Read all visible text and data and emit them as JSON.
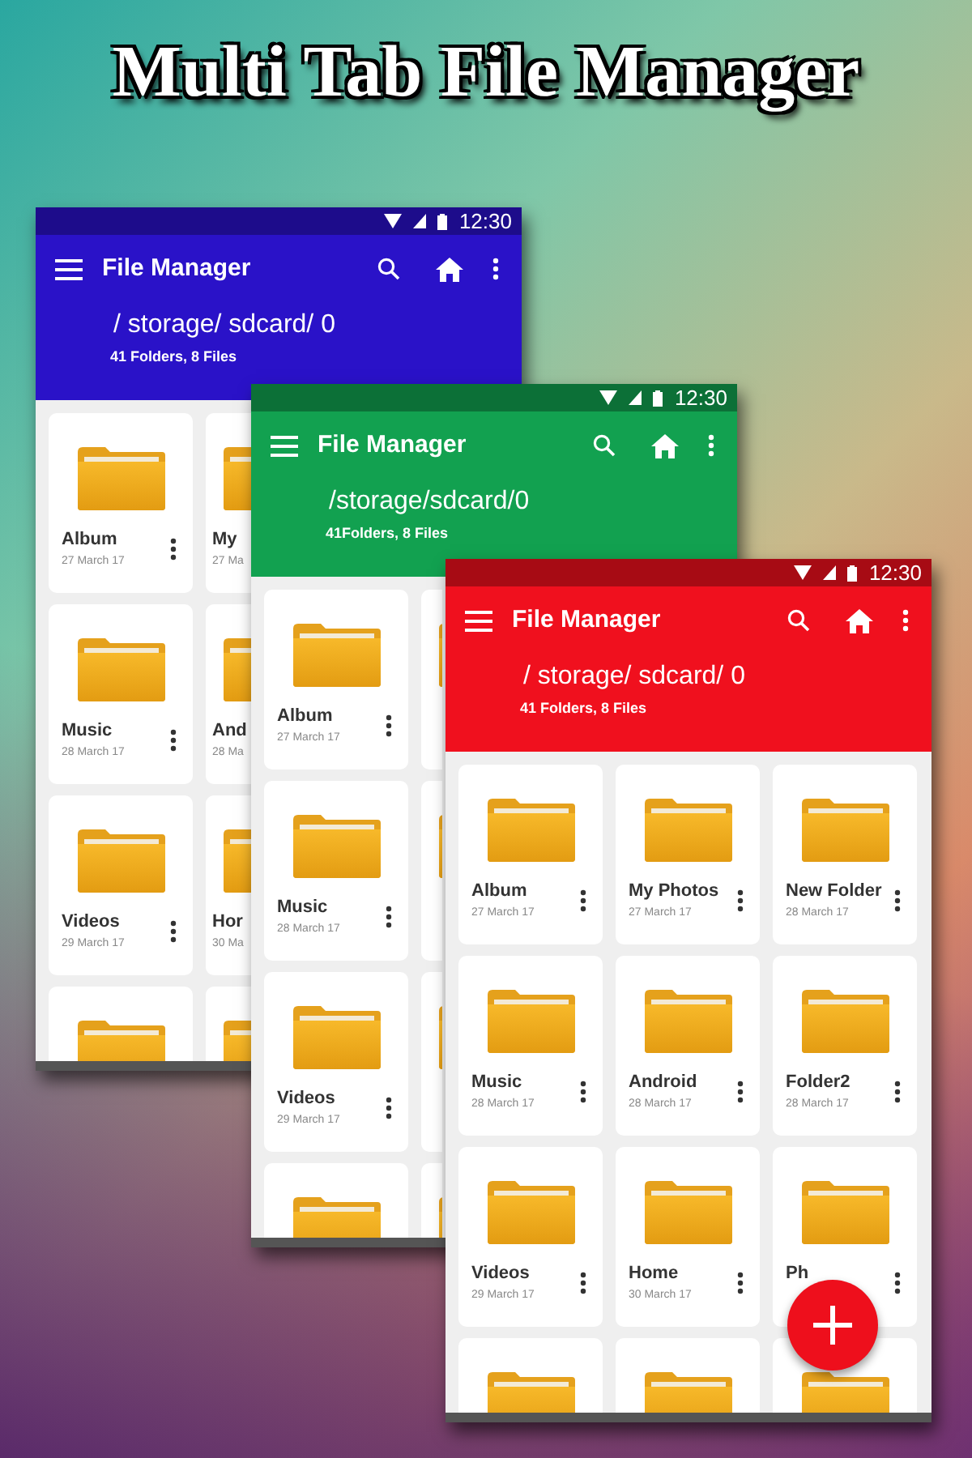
{
  "title": "Multi Tab File Manager",
  "screens": [
    {
      "color": "#2a12c8",
      "time": "12:30",
      "app_title": "File Manager",
      "path": "/ storage/ sdcard/ 0",
      "summary": "41 Folders, 8 Files",
      "rows": [
        [
          {
            "kind": "folder",
            "name": "Album",
            "date": "27 March 17"
          },
          {
            "kind": "folder",
            "name": "My",
            "date": "27 Ma"
          }
        ],
        [
          {
            "kind": "folder",
            "name": "Music",
            "date": "28 March 17"
          },
          {
            "kind": "folder",
            "name": "And",
            "date": "28 Ma"
          }
        ],
        [
          {
            "kind": "folder",
            "name": "Videos",
            "date": "29 March 17"
          },
          {
            "kind": "folder",
            "name": "Hor",
            "date": "30 Ma"
          }
        ],
        [
          {
            "kind": "cut"
          },
          {
            "kind": "cut"
          }
        ]
      ]
    },
    {
      "color": "#12a150",
      "time": "12:30",
      "app_title": "File Manager",
      "path": "/storage/sdcard/0",
      "summary": "41Folders, 8 Files",
      "rows": [
        [
          {
            "kind": "folder",
            "name": "Album",
            "date": "27 March 17"
          },
          {
            "kind": "cut"
          }
        ],
        [
          {
            "kind": "folder",
            "name": "Music",
            "date": "28 March 17"
          },
          {
            "kind": "cut"
          }
        ],
        [
          {
            "kind": "folder",
            "name": "Videos",
            "date": "29 March 17"
          },
          {
            "kind": "cut"
          }
        ],
        [
          {
            "kind": "cut"
          },
          {
            "kind": "cut"
          }
        ]
      ]
    },
    {
      "color": "#f0101e",
      "time": "12:30",
      "app_title": "File Manager",
      "path": "/ storage/ sdcard/ 0",
      "summary": "41 Folders, 8 Files",
      "fab": true,
      "rows": [
        [
          {
            "kind": "folder",
            "name": "Album",
            "date": "27 March 17"
          },
          {
            "kind": "folder",
            "name": "My Photos",
            "date": "27 March 17"
          },
          {
            "kind": "folder",
            "name": "New Folder",
            "date": "28 March 17"
          }
        ],
        [
          {
            "kind": "folder",
            "name": "Music",
            "date": "28 March 17"
          },
          {
            "kind": "folder",
            "name": "Android",
            "date": "28 March 17"
          },
          {
            "kind": "folder",
            "name": "Folder2",
            "date": "28 March 17"
          }
        ],
        [
          {
            "kind": "folder",
            "name": "Videos",
            "date": "29 March 17"
          },
          {
            "kind": "folder",
            "name": "Home",
            "date": "30 March 17"
          },
          {
            "kind": "folder",
            "name": "Ph"
          }
        ],
        [
          {
            "kind": "cut"
          },
          {
            "kind": "cut"
          },
          {
            "kind": "cut"
          }
        ]
      ]
    }
  ]
}
